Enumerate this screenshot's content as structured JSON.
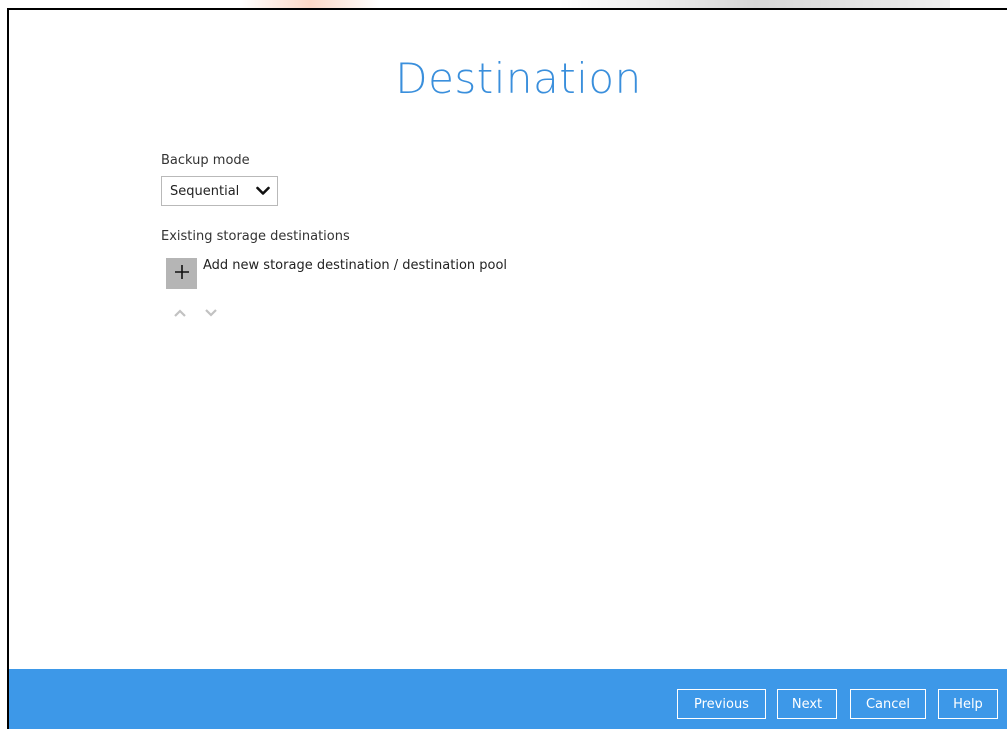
{
  "header": {
    "title": "Destination"
  },
  "backup_mode": {
    "label": "Backup mode",
    "selected": "Sequential"
  },
  "storage": {
    "label": "Existing storage destinations",
    "add_label": "Add new storage destination / destination pool"
  },
  "footer": {
    "previous_label": "Previous",
    "next_label": "Next",
    "cancel_label": "Cancel",
    "help_label": "Help"
  },
  "colors": {
    "accent": "#3a8fdc",
    "footer_bg": "#3d98e8",
    "add_button_bg": "#b5b5b5"
  },
  "icons": {
    "select_chevron": "chevron-down-icon",
    "add": "plus-icon",
    "move_up": "chevron-up-icon",
    "move_down": "chevron-down-icon"
  }
}
